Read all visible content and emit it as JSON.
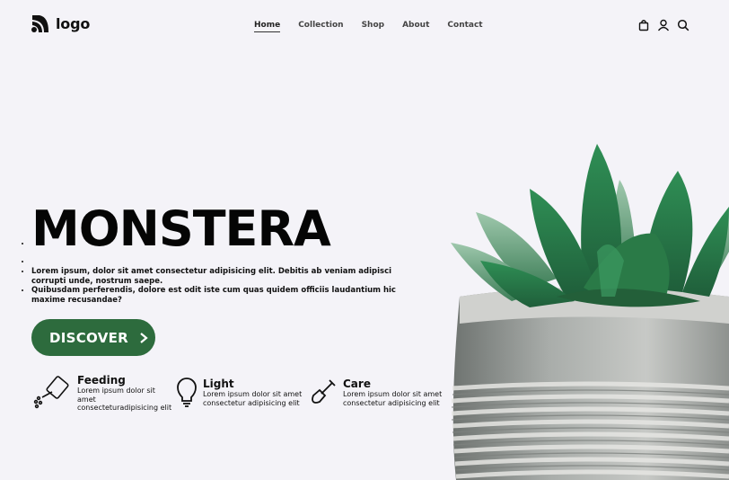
{
  "header": {
    "logo_text": "logo",
    "nav": [
      {
        "label": "Home",
        "active": true
      },
      {
        "label": "Collection",
        "active": false
      },
      {
        "label": "Shop",
        "active": false
      },
      {
        "label": "About",
        "active": false
      },
      {
        "label": "Contact",
        "active": false
      }
    ],
    "icons": [
      "shopping-bag-icon",
      "user-icon",
      "search-icon"
    ]
  },
  "hero": {
    "title": "MONSTERA",
    "paragraphs": [
      "Lorem ipsum, dolor sit amet consectetur adipisicing elit. Debitis ab veniam adipisci corrupti unde, nostrum saepe.",
      "Quibusdam perferendis, dolore est odit iste cum quas quidem officiis laudantium hic maxime recusandae?"
    ],
    "cta_label": "DISCOVER"
  },
  "features": [
    {
      "icon": "watering-can-icon",
      "title": "Feeding",
      "text": "Lorem ipsum dolor sit amet consecteturadipisicing elit"
    },
    {
      "icon": "light-bulb-icon",
      "title": "Light",
      "text": "Lorem ipsum dolor sit amet consectetur adipisicing elit"
    },
    {
      "icon": "shovel-icon",
      "title": "Care",
      "text": "Lorem ipsum dolor sit amet consectetur adipisicing elit"
    }
  ],
  "colors": {
    "background": "#f4f3f8",
    "accent": "#2d6b3d",
    "text": "#111111"
  }
}
